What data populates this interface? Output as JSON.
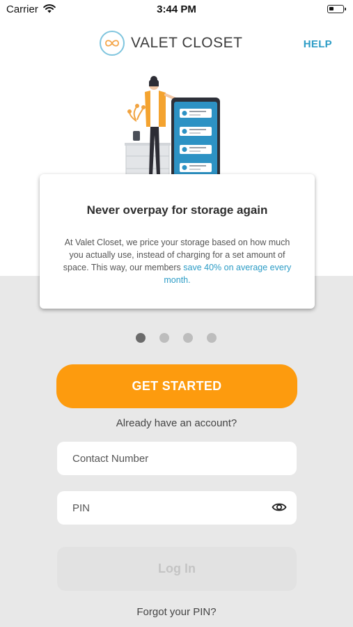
{
  "status_bar": {
    "carrier": "Carrier",
    "time": "3:44 PM"
  },
  "header": {
    "brand_name": "VALET CLOSET",
    "help_label": "HELP"
  },
  "onboarding": {
    "title": "Never overpay for storage again",
    "body": "At Valet Closet, we price your storage based on how much you actually use, instead of charging for a set amount of space. This way, our members ",
    "body_highlight": "save 40% on average every month.",
    "page_count": 4,
    "active_page": 1
  },
  "actions": {
    "get_started_label": "GET STARTED",
    "have_account_text": "Already have an account?"
  },
  "login": {
    "contact_placeholder": "Contact Number",
    "pin_placeholder": "PIN",
    "login_label": "Log In",
    "forgot_label": "Forgot your PIN?"
  },
  "colors": {
    "accent": "#fd9b0e",
    "link": "#2c9cc6",
    "background_band": "#e8e8e8"
  },
  "icons": [
    "wifi-icon",
    "battery-icon",
    "valet-closet-logo",
    "eye-icon"
  ]
}
